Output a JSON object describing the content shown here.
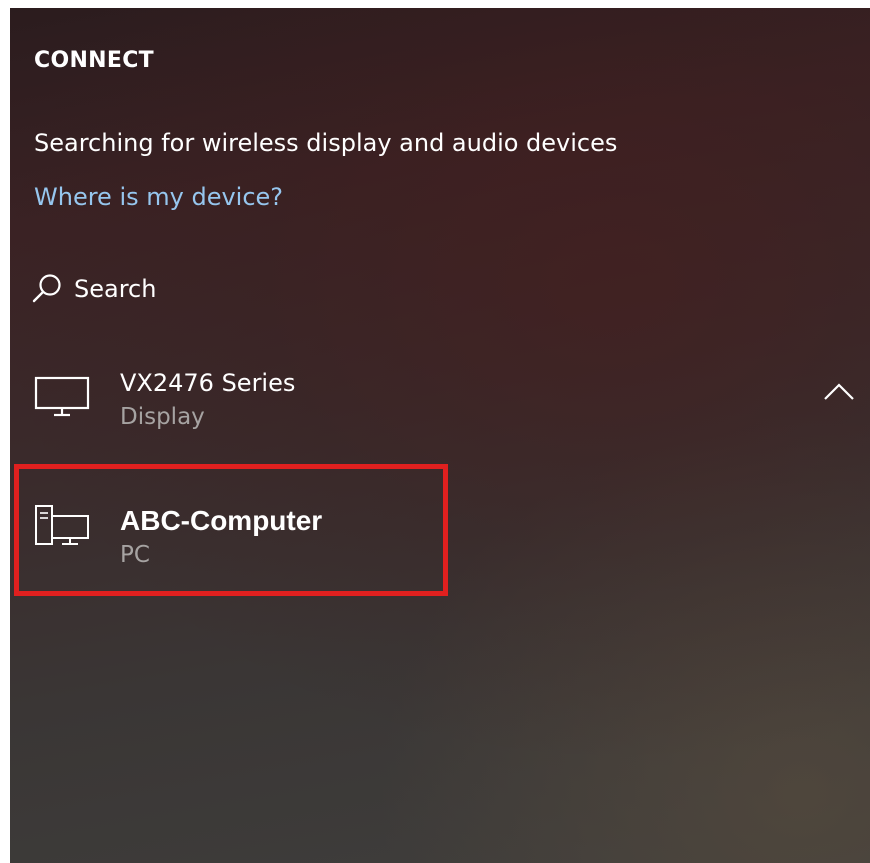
{
  "panel": {
    "heading": "CONNECT",
    "status_text": "Searching for wireless display and audio devices",
    "help_link": "Where is my device?"
  },
  "search": {
    "label": "Search",
    "icon": "search-icon"
  },
  "devices": [
    {
      "name": "VX2476 Series",
      "type": "Display",
      "icon": "monitor-icon",
      "expanded": true,
      "expand_icon": "chevron-up-icon"
    },
    {
      "name": "ABC-Computer",
      "type": "PC",
      "icon": "pc-icon",
      "highlighted": true
    }
  ],
  "colors": {
    "link": "#96c6ee",
    "highlight": "#e0201f",
    "secondary_text": "#a6a3a2"
  }
}
